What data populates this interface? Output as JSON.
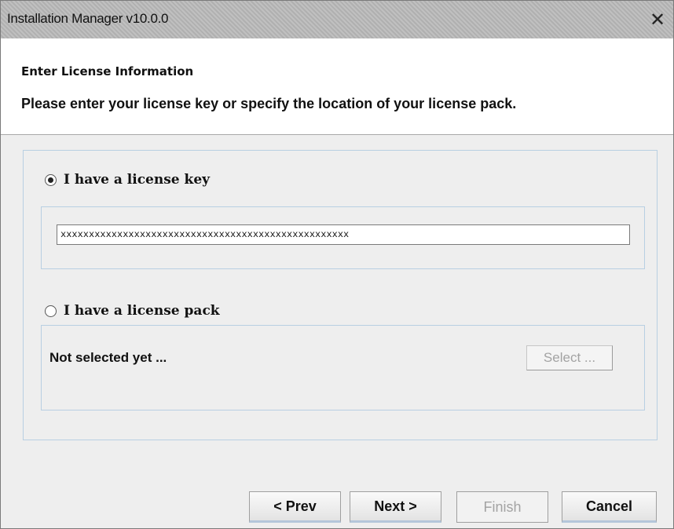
{
  "window": {
    "title": "Installation Manager v10.0.0",
    "close_label": "✕"
  },
  "header": {
    "section_title": "Enter License Information",
    "description": "Please enter your license key or specify the location of your license pack."
  },
  "license_key_option": {
    "label": "I have a license key",
    "selected": true,
    "input_value": "xxxxxxxxxxxxxxxxxxxxxxxxxxxxxxxxxxxxxxxxxxxxxxxxxxx"
  },
  "license_pack_option": {
    "label": "I have a license pack",
    "selected": false,
    "status": "Not selected yet ...",
    "select_button": "Select ..."
  },
  "buttons": {
    "prev": "< Prev",
    "next": "Next >",
    "finish": "Finish",
    "cancel": "Cancel"
  },
  "colors": {
    "titlebar": "#b9b9b9",
    "panel_border": "#b8cfe2",
    "background": "#eeeeee"
  }
}
